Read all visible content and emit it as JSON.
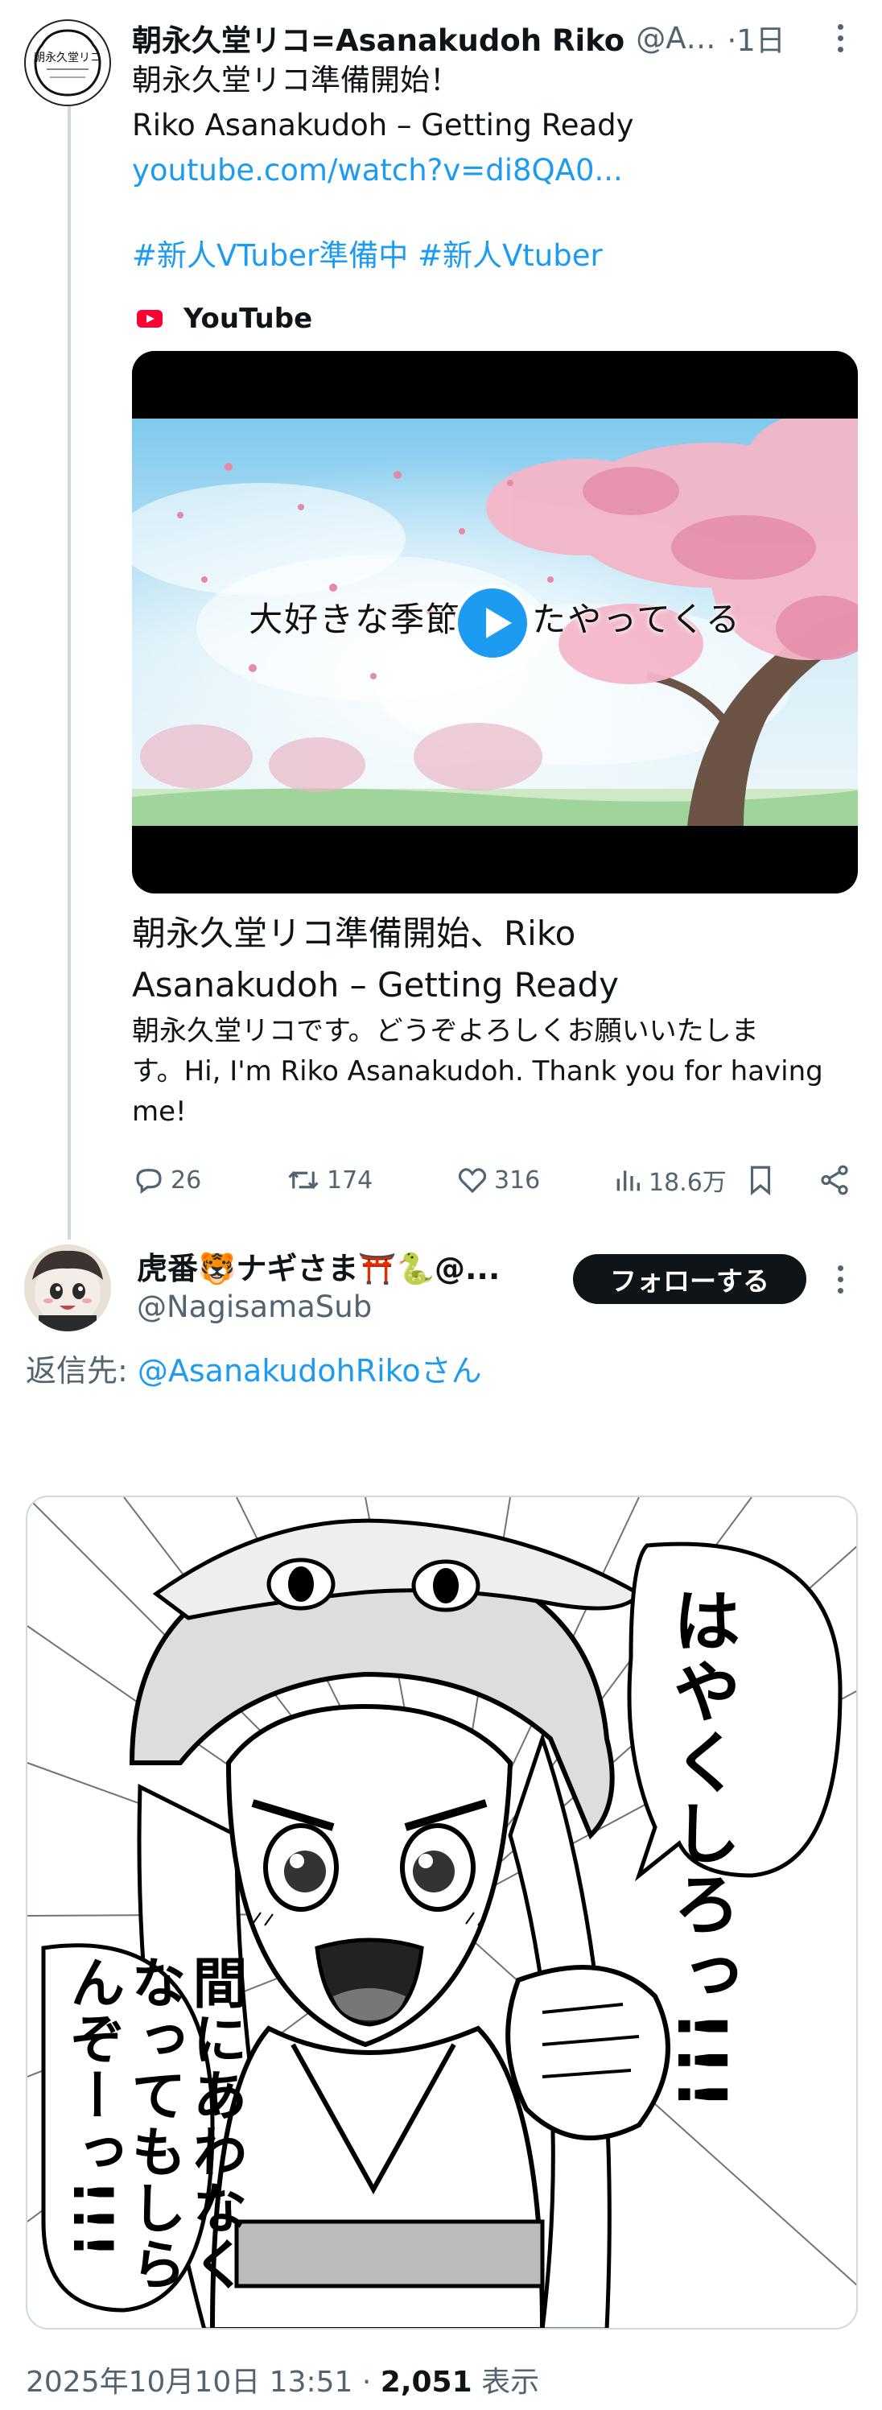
{
  "tweet": {
    "author_name": "朝永久堂リコ=Asanakudoh Riko",
    "author_handle": "@A…",
    "time": "·1日",
    "avatar_text": "朝永久堂リコ",
    "line1": "朝永久堂リコ準備開始！",
    "line2": "Riko Asanakudoh – Getting Ready",
    "link": "youtube.com/watch?v=di8QA0...",
    "hashtag1": "#新人VTuber準備中",
    "hashtag2": "#新人Vtuber",
    "source_label": "YouTube",
    "video_caption": "大好きな季節がまたやってくる",
    "card_title_line1": "朝永久堂リコ準備開始、Riko",
    "card_title_line2": "Asanakudoh – Getting Ready",
    "card_desc_line1": "朝永久堂リコです。どうぞよろしくお願いいたしま",
    "card_desc_line2": "す。Hi, I'm Riko Asanakudoh. Thank you for having",
    "card_desc_line3": "me!",
    "replies": "26",
    "reposts": "174",
    "likes": "316",
    "views": "18.6万"
  },
  "reply": {
    "author_name": "虎番🐯ナギさま⛩️🐍@...",
    "author_handle": "@NagisamaSub",
    "follow_label": "フォローする",
    "reply_to_prefix": "返信先: ",
    "reply_to_handle": "@AsanakudohRikoさん",
    "manga_text1": "はやくしろっ!!!",
    "manga_text2": "間にあわなくなってもしらんぞーっ!!!",
    "date": "2025年10月10日 13:51 · ",
    "views_count": "2,051",
    "views_label": " 表示"
  },
  "icons": [
    "reply-icon",
    "repost-icon",
    "like-icon",
    "views-icon",
    "bookmark-icon",
    "share-icon",
    "more-icon",
    "youtube-icon",
    "play-icon"
  ],
  "colors": {
    "accent": "#1d9bf0",
    "muted": "#536471",
    "text": "#0f1419",
    "youtube": "#ff0033"
  }
}
